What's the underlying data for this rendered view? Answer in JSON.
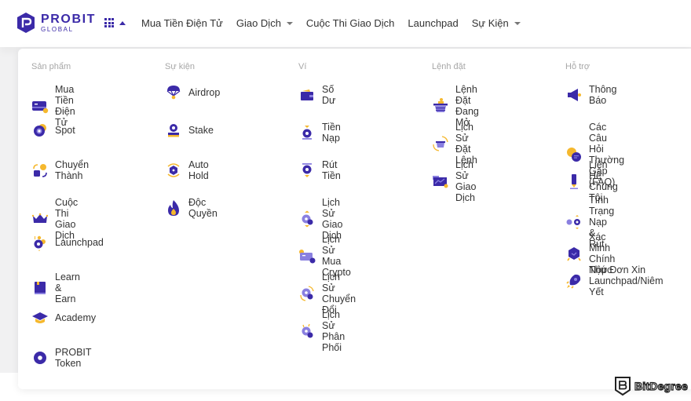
{
  "header": {
    "logo": {
      "main": "PROBIT",
      "sub": "GLOBAL"
    },
    "apps_menu_icon": "grid-icon",
    "nav": [
      {
        "label": "Mua Tiền Điện Tử",
        "has_dropdown": false
      },
      {
        "label": "Giao Dịch",
        "has_dropdown": true
      },
      {
        "label": "Cuộc Thi Giao Dịch",
        "has_dropdown": false
      },
      {
        "label": "Launchpad",
        "has_dropdown": false
      },
      {
        "label": "Sự Kiện",
        "has_dropdown": true
      }
    ]
  },
  "menu": {
    "columns": [
      {
        "title": "Sản phẩm",
        "items": [
          {
            "label": "Mua Tiền Điện Tử",
            "icon": "credit-card-icon"
          },
          {
            "label": "Spot",
            "icon": "spot-coin-icon"
          },
          {
            "label": "Chuyển Thành",
            "icon": "convert-icon"
          },
          {
            "label": "Cuộc Thi Giao Dịch",
            "icon": "crown-icon"
          },
          {
            "label": "Launchpad",
            "icon": "launchpad-icon"
          },
          {
            "label": "Learn & Earn",
            "icon": "book-icon"
          },
          {
            "label": "Academy",
            "icon": "graduation-cap-icon"
          },
          {
            "label": "PROBIT Token",
            "icon": "token-icon"
          }
        ]
      },
      {
        "title": "Sự kiện",
        "items": [
          {
            "label": "Airdrop",
            "icon": "parachute-icon"
          },
          {
            "label": "Stake",
            "icon": "stake-icon"
          },
          {
            "label": "Auto Hold",
            "icon": "auto-hold-icon"
          },
          {
            "label": "Độc Quyền",
            "icon": "flame-icon"
          }
        ]
      },
      {
        "title": "Ví",
        "items": [
          {
            "label": "Số Dư",
            "icon": "wallet-icon"
          },
          {
            "label": "Tiền Nạp",
            "icon": "deposit-icon"
          },
          {
            "label": "Rút Tiền",
            "icon": "withdraw-icon"
          },
          {
            "label": "Lịch Sử Giao Dịch",
            "icon": "transaction-history-icon"
          },
          {
            "label": "Lịch Sử Mua Crypto",
            "icon": "purchase-history-icon"
          },
          {
            "label": "Lịch Sử Chuyển Đổi",
            "icon": "conversion-history-icon"
          },
          {
            "label": "Lịch Sử Phân Phối",
            "icon": "distribution-history-icon"
          }
        ]
      },
      {
        "title": "Lệnh đặt",
        "items": [
          {
            "label": "Lệnh Đặt Đang Mở",
            "icon": "open-orders-basket-icon"
          },
          {
            "label": "Lịch Sử Đặt Lệnh",
            "icon": "order-history-icon"
          },
          {
            "label": "Lịch Sử Giao Dịch",
            "icon": "trade-history-chart-icon"
          }
        ]
      },
      {
        "title": "Hỗ trợ",
        "items": [
          {
            "label": "Thông Báo",
            "icon": "megaphone-icon"
          },
          {
            "label": "Các Câu Hỏi\nThường Gặp (FAQ)",
            "icon": "faq-chat-icon"
          },
          {
            "label": "Liên Hệ Chúng Tôi",
            "icon": "contact-pen-icon"
          },
          {
            "label": "Tình Trạng Nạp &\nRút",
            "icon": "status-icon"
          },
          {
            "label": "Xác Minh Chính\nThức",
            "icon": "verification-shield-icon"
          },
          {
            "label": "Nộp Đơn Xin\nLaunchpad/Niêm\nYết",
            "icon": "rocket-icon"
          }
        ]
      }
    ]
  },
  "watermark": {
    "label": "BitDegree"
  },
  "colors": {
    "brand": "#3b2aa8",
    "accent_yellow": "#f5b82e",
    "light_purple": "#8a80e0"
  }
}
